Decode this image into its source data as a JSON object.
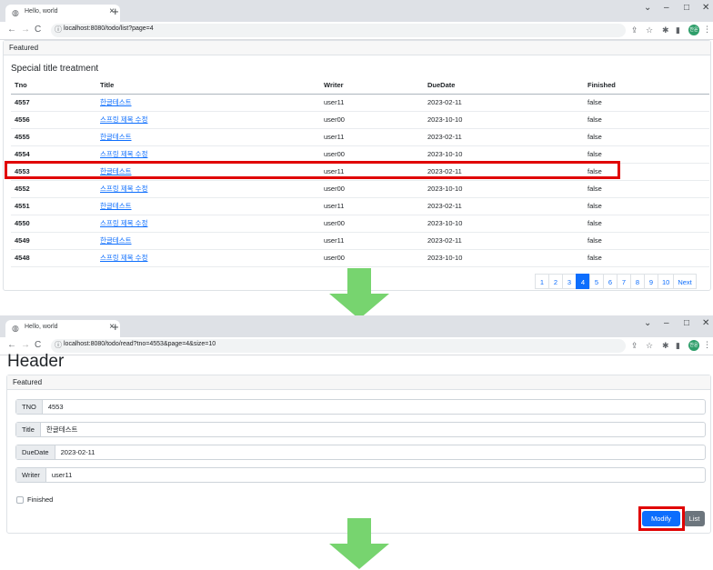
{
  "browser": {
    "tab_title": "Hello, world",
    "tab_close": "×",
    "new_tab": "+",
    "win_minimize": "–",
    "win_maximize": "□",
    "win_close": "✕",
    "win_chevron": "⌄",
    "nav_back": "←",
    "nav_forward": "→",
    "nav_reload": "C",
    "profile_initials": "찬윤",
    "icons": [
      "share-icon",
      "star-icon",
      "extension-icon",
      "sidepanel-icon",
      "profile-avatar",
      "menu-icon"
    ]
  },
  "list_page": {
    "url": "localhost:8080/todo/list?page=4",
    "card_header": "Featured",
    "card_title": "Special title treatment",
    "columns": [
      "Tno",
      "Title",
      "Writer",
      "DueDate",
      "Finished"
    ],
    "rows": [
      {
        "tno": "4557",
        "title": "한글테스트",
        "writer": "user11",
        "due": "2023-02-11",
        "finished": "false"
      },
      {
        "tno": "4556",
        "title": "스프링 제목 수정",
        "writer": "user00",
        "due": "2023-10-10",
        "finished": "false"
      },
      {
        "tno": "4555",
        "title": "한글테스트",
        "writer": "user11",
        "due": "2023-02-11",
        "finished": "false"
      },
      {
        "tno": "4554",
        "title": "스프링 제목 수정",
        "writer": "user00",
        "due": "2023-10-10",
        "finished": "false"
      },
      {
        "tno": "4553",
        "title": "한글테스트",
        "writer": "user11",
        "due": "2023-02-11",
        "finished": "false"
      },
      {
        "tno": "4552",
        "title": "스프링 제목 수정",
        "writer": "user00",
        "due": "2023-10-10",
        "finished": "false"
      },
      {
        "tno": "4551",
        "title": "한글테스트",
        "writer": "user11",
        "due": "2023-02-11",
        "finished": "false"
      },
      {
        "tno": "4550",
        "title": "스프링 제목 수정",
        "writer": "user00",
        "due": "2023-10-10",
        "finished": "false"
      },
      {
        "tno": "4549",
        "title": "한글테스트",
        "writer": "user11",
        "due": "2023-02-11",
        "finished": "false"
      },
      {
        "tno": "4548",
        "title": "스프링 제목 수정",
        "writer": "user00",
        "due": "2023-10-10",
        "finished": "false"
      }
    ],
    "pagination": [
      "1",
      "2",
      "3",
      "4",
      "5",
      "6",
      "7",
      "8",
      "9",
      "10",
      "Next"
    ],
    "active_page": "4"
  },
  "read_page": {
    "url": "localhost:8080/todo/read?tno=4553&page=4&size=10",
    "header": "Header",
    "card_header": "Featured",
    "fields": [
      {
        "label": "TNO",
        "value": "4553"
      },
      {
        "label": "Title",
        "value": "한글테스트"
      },
      {
        "label": "DueDate",
        "value": "2023-02-11"
      },
      {
        "label": "Writer",
        "value": "user11"
      }
    ],
    "finished_label": "Finished",
    "modify_label": "Modify",
    "list_label": "List"
  },
  "colors": {
    "highlight": "#e00000",
    "arrow": "#77d46f",
    "primary": "#0d6efd",
    "secondary": "#6c757d"
  }
}
